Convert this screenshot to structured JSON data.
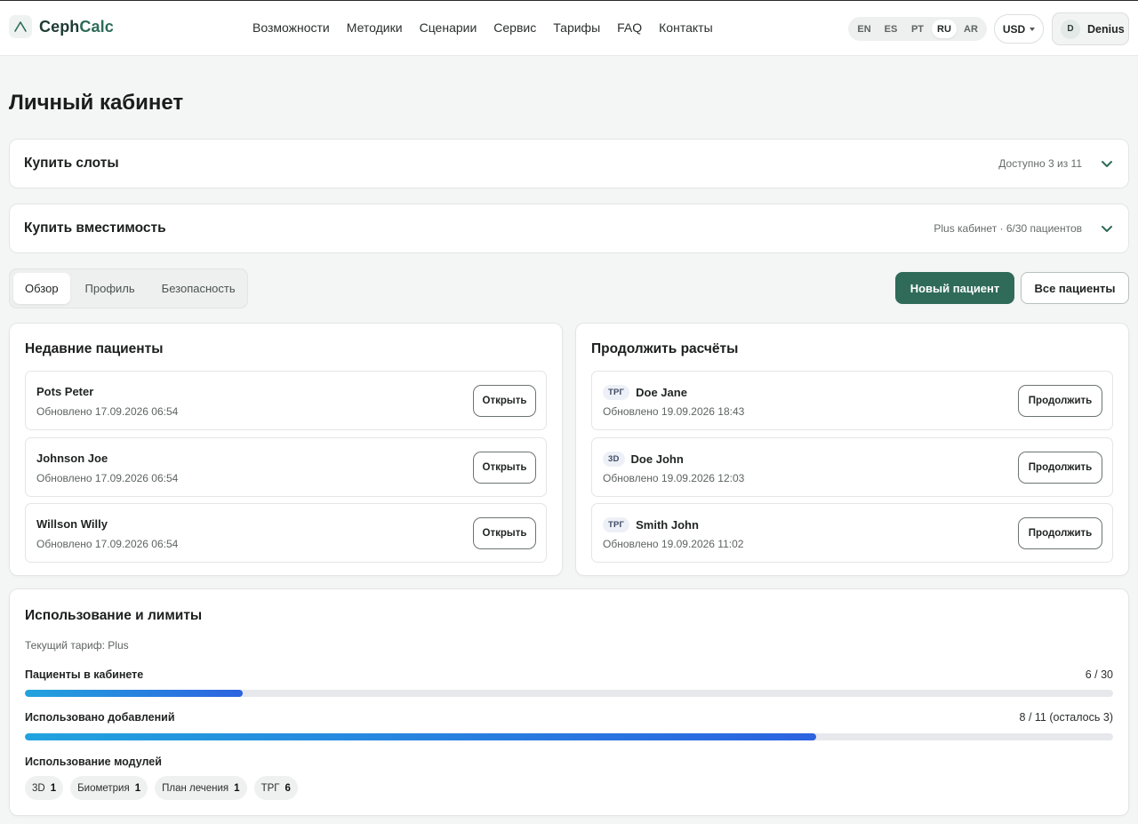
{
  "header": {
    "brand_part1": "Ceph",
    "brand_part2": "Calc",
    "nav": [
      "Возможности",
      "Методики",
      "Сценарии",
      "Сервис",
      "Тарифы",
      "FAQ",
      "Контакты"
    ],
    "languages": [
      "EN",
      "ES",
      "PT",
      "RU",
      "AR"
    ],
    "active_language": "RU",
    "currency": "USD",
    "user_initial": "D",
    "user_name": "Denius"
  },
  "page_title": "Личный кабинет",
  "accordions": [
    {
      "title": "Купить слоты",
      "meta": "Доступно 3 из 11"
    },
    {
      "title": "Купить вместимость",
      "meta": "Plus кабинет · 6/30 пациентов"
    }
  ],
  "tabs": [
    "Обзор",
    "Профиль",
    "Безопасность"
  ],
  "active_tab": "Обзор",
  "actions": {
    "new_patient": "Новый пациент",
    "all_patients": "Все пациенты"
  },
  "recent": {
    "title": "Недавние пациенты",
    "button_label": "Открыть",
    "items": [
      {
        "name": "Pots Peter",
        "updated": "Обновлено 17.09.2026 06:54"
      },
      {
        "name": "Johnson Joe",
        "updated": "Обновлено 17.09.2026 06:54"
      },
      {
        "name": "Willson Willy",
        "updated": "Обновлено 17.09.2026 06:54"
      }
    ]
  },
  "continue": {
    "title": "Продолжить расчёты",
    "button_label": "Продолжить",
    "items": [
      {
        "badge": "ТРГ",
        "name": "Doe Jane",
        "updated": "Обновлено 19.09.2026 18:43"
      },
      {
        "badge": "3D",
        "name": "Doe John",
        "updated": "Обновлено 19.09.2026 12:03"
      },
      {
        "badge": "ТРГ",
        "name": "Smith John",
        "updated": "Обновлено 19.09.2026 11:02"
      }
    ]
  },
  "usage": {
    "title": "Использование и лимиты",
    "plan": "Текущий тариф: Plus",
    "metrics": [
      {
        "label": "Пациенты в кабинете",
        "value": "6 / 30",
        "fraction": 0.2
      },
      {
        "label": "Использовано добавлений",
        "value": "8 / 11 (осталось 3)",
        "fraction": 0.7273
      }
    ],
    "modules_label": "Использование модулей",
    "modules": [
      {
        "name": "3D",
        "count": "1"
      },
      {
        "name": "Биометрия",
        "count": "1"
      },
      {
        "name": "План лечения",
        "count": "1"
      },
      {
        "name": "ТРГ",
        "count": "6"
      }
    ]
  },
  "colors": {
    "brand": "#2f6b58",
    "bar_start": "#22a3de",
    "bar_end": "#2d63e0",
    "track": "#e6e8ec"
  }
}
